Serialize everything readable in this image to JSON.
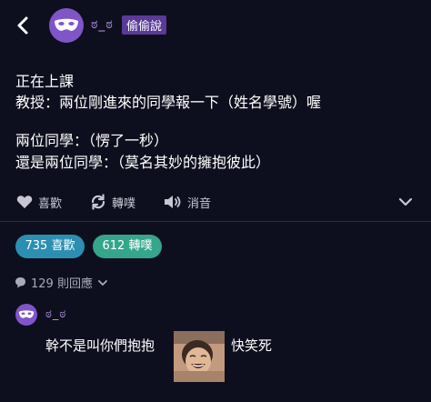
{
  "header": {
    "author": "ಠ_ಠ",
    "board": "偷偷說"
  },
  "post": {
    "lines": [
      "正在上課",
      "教授：兩位剛進來的同學報一下（姓名學號）喔",
      "兩位同學：（愣了一秒）",
      "還是兩位同學：（莫名其妙的擁抱彼此）"
    ]
  },
  "actions": {
    "like": "喜歡",
    "share": "轉噗",
    "mute": "消音"
  },
  "stats": {
    "likes": "735 喜歡",
    "shares": "612 轉噗"
  },
  "replies": {
    "count_label": "129 則回應"
  },
  "reply": {
    "author": "ಠ_ಠ",
    "text_before": "幹不是叫你們抱抱",
    "text_after": "快笑死"
  },
  "colors": {
    "background": "#0e0f1e",
    "accent_purple": "#7f55c8",
    "like_pill": "#2c8fb2",
    "share_pill": "#35a58b"
  }
}
